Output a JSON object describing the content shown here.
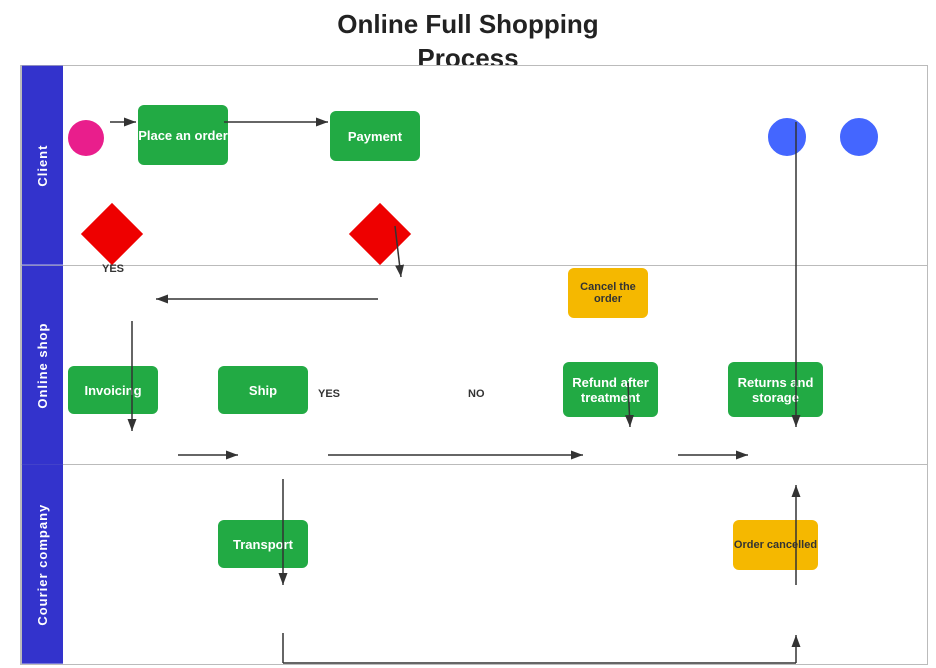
{
  "title": {
    "line1": "Online Full Shopping",
    "line2": "Process"
  },
  "lanes": [
    {
      "id": "client",
      "label": "Client"
    },
    {
      "id": "online-shop",
      "label": "Online shop"
    },
    {
      "id": "courier-company",
      "label": "Courier company"
    }
  ],
  "shapes": {
    "start_circle": {
      "label": ""
    },
    "place_order": {
      "label": "Place an order"
    },
    "payment": {
      "label": "Payment"
    },
    "diamond_right": {
      "label": ""
    },
    "diamond_left": {
      "label": ""
    },
    "invoicing": {
      "label": "Invoicing"
    },
    "ship": {
      "label": "Ship"
    },
    "cancel_order": {
      "label": "Cancel the order"
    },
    "refund": {
      "label": "Refund after treatment"
    },
    "returns_storage": {
      "label": "Returns and storage"
    },
    "transport": {
      "label": "Transport"
    },
    "order_cancelled": {
      "label": "Order cancelled"
    },
    "end_circle1": {
      "label": ""
    },
    "end_circle2": {
      "label": ""
    }
  },
  "flow_labels": {
    "yes_left": "YES",
    "yes_right": "YES",
    "no": "NO"
  }
}
